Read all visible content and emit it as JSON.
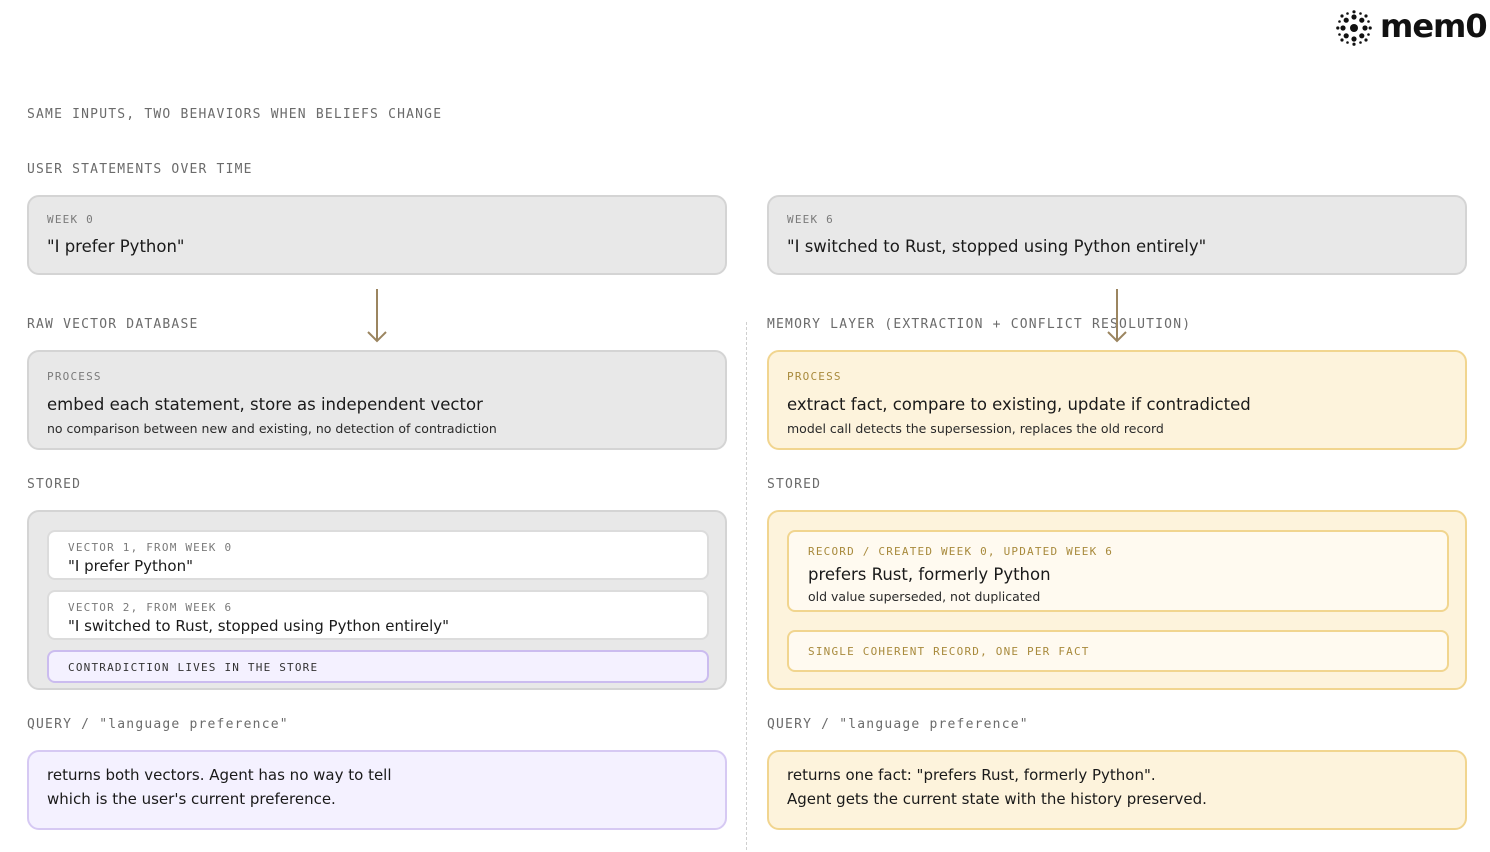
{
  "brand": {
    "name": "mem0"
  },
  "heading": "SAME INPUTS, TWO BEHAVIORS WHEN BELIEFS CHANGE",
  "statements": {
    "label": "USER STATEMENTS OVER TIME",
    "week0": {
      "tag": "WEEK 0",
      "quote": "\"I prefer Python\""
    },
    "week6": {
      "tag": "WEEK 6",
      "quote": "\"I switched to Rust, stopped using Python entirely\""
    }
  },
  "left": {
    "label": "RAW VECTOR DATABASE",
    "process": {
      "tag": "PROCESS",
      "title": "embed each statement, store as independent vector",
      "sub": "no comparison between new and existing, no detection of contradiction"
    },
    "stored_label": "STORED",
    "vectors": [
      {
        "tag": "VECTOR 1, FROM WEEK 0",
        "quote": "\"I prefer Python\""
      },
      {
        "tag": "VECTOR 2, FROM WEEK 6",
        "quote": "\"I switched to Rust, stopped using Python entirely\""
      }
    ],
    "contradiction": "CONTRADICTION LIVES IN THE STORE",
    "query_label": "QUERY / \"language preference\"",
    "answer_line1": "returns both vectors. Agent has no way to tell",
    "answer_line2": "which is the user's current preference."
  },
  "right": {
    "label": "MEMORY LAYER (EXTRACTION + CONFLICT RESOLUTION)",
    "process": {
      "tag": "PROCESS",
      "title": "extract fact, compare to existing, update if contradicted",
      "sub": "model call detects the supersession, replaces the old record"
    },
    "stored_label": "STORED",
    "record": {
      "tag": "RECORD / CREATED WEEK 0, UPDATED WEEK 6",
      "title": "prefers Rust, formerly Python",
      "sub": "old value superseded, not duplicated"
    },
    "coherent": "SINGLE COHERENT RECORD, ONE PER FACT",
    "query_label": "QUERY / \"language preference\"",
    "answer_line1": "returns one fact: \"prefers Rust, formerly Python\".",
    "answer_line2": "Agent gets the current state with the history preserved."
  }
}
